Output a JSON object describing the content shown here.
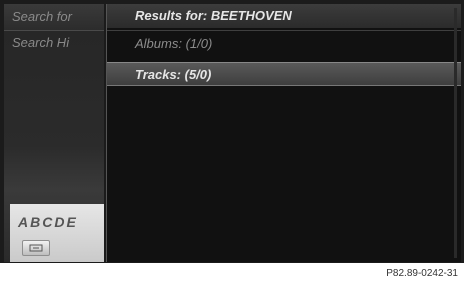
{
  "left_panel": {
    "items": [
      {
        "label": "Search for"
      },
      {
        "label": "Search Hi"
      }
    ],
    "keyboard_letters": "ABCDE"
  },
  "results": {
    "header": "Results for: BEETHOVEN",
    "rows": [
      {
        "label": "Albums: (1/0)",
        "selected": false
      },
      {
        "label": "Tracks: (5/0)",
        "selected": true
      }
    ]
  },
  "footer": {
    "figure_code": "P82.89-0242-31"
  }
}
